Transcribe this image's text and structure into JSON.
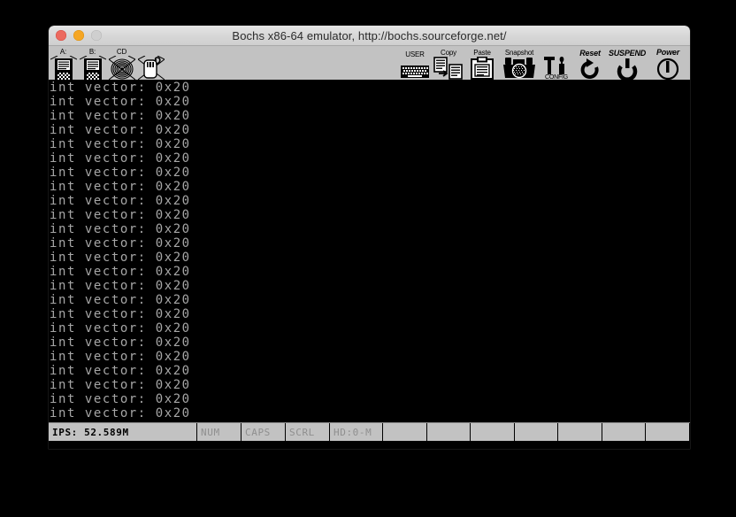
{
  "window": {
    "title": "Bochs x86-64 emulator, http://bochs.sourceforge.net/",
    "traffic_lights": {
      "close_label": "close",
      "minimize_label": "minimize",
      "zoom_label": "zoom"
    }
  },
  "toolbar": {
    "left_buttons": [
      {
        "name": "floppy-a",
        "label": "A:",
        "icon": "floppy-icon"
      },
      {
        "name": "floppy-b",
        "label": "B:",
        "icon": "floppy-icon"
      },
      {
        "name": "cdrom",
        "label": "CD",
        "icon": "cdrom-icon"
      },
      {
        "name": "mouse",
        "label": "",
        "icon": "mouse-icon"
      }
    ],
    "right_buttons": [
      {
        "name": "user",
        "label": "USER",
        "icon": "keyboard-icon",
        "style": "plain"
      },
      {
        "name": "copy",
        "label": "Copy",
        "icon": "copy-icon",
        "style": "plain"
      },
      {
        "name": "paste",
        "label": "Paste",
        "icon": "clipboard-icon",
        "style": "plain"
      },
      {
        "name": "snapshot",
        "label": "Snapshot",
        "icon": "camera-icon",
        "style": "plain"
      },
      {
        "name": "config",
        "label": "CONFIG",
        "icon": "tools-icon",
        "style": "under"
      },
      {
        "name": "reset",
        "label": "Reset",
        "icon": "reset-arrow-icon",
        "style": "italic"
      },
      {
        "name": "suspend",
        "label": "SUSPEND",
        "icon": "power-standby-icon",
        "style": "italic"
      },
      {
        "name": "power",
        "label": "Power",
        "icon": "power-circle-icon",
        "style": "italic"
      }
    ]
  },
  "screen": {
    "text_color": "#a6a6a6",
    "background_color": "#000000",
    "lines": [
      "int vector: 0x20",
      "int vector: 0x20",
      "int vector: 0x20",
      "int vector: 0x20",
      "int vector: 0x20",
      "int vector: 0x20",
      "int vector: 0x20",
      "int vector: 0x20",
      "int vector: 0x20",
      "int vector: 0x20",
      "int vector: 0x20",
      "int vector: 0x20",
      "int vector: 0x20",
      "int vector: 0x20",
      "int vector: 0x20",
      "int vector: 0x20",
      "int vector: 0x20",
      "int vector: 0x20",
      "int vector: 0x20",
      "int vector: 0x20",
      "int vector: 0x20",
      "int vector: 0x20",
      "int vector: 0x20",
      "int vector: 0x20"
    ]
  },
  "statusbar": {
    "ips": "IPS: 52.589M",
    "indicators": [
      {
        "name": "num-lock",
        "label": "NUM",
        "state": "inactive"
      },
      {
        "name": "caps-lock",
        "label": "CAPS",
        "state": "inactive"
      },
      {
        "name": "scroll-lock",
        "label": "SCRL",
        "state": "inactive"
      }
    ],
    "hd": {
      "name": "hd-activity",
      "label": "HD:0-M",
      "state": "inactive"
    },
    "empty_cells": 7
  }
}
